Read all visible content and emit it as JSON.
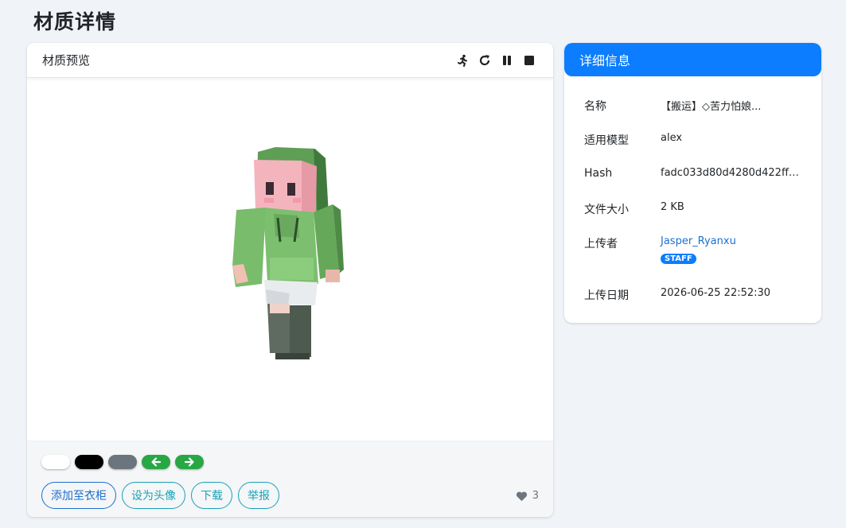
{
  "page": {
    "title": "材质详情"
  },
  "preview": {
    "title": "材质预览",
    "tools": [
      "run-icon",
      "reset-icon",
      "pause-icon",
      "stop-icon"
    ],
    "swatches": [
      {
        "name": "white",
        "color": "#ffffff"
      },
      {
        "name": "black",
        "color": "#000000"
      },
      {
        "name": "gray",
        "color": "#6c757d"
      },
      {
        "name": "prev",
        "color": "#28a745"
      },
      {
        "name": "next",
        "color": "#28a745"
      }
    ],
    "buttons": {
      "add_closet": "添加至衣柜",
      "set_avatar": "设为头像",
      "download": "下载",
      "report": "举报"
    },
    "likes": "3"
  },
  "info": {
    "title": "详细信息",
    "name_label": "名称",
    "name_value": "【搬运】◇苦力怕娘...",
    "model_label": "适用模型",
    "model_value": "alex",
    "hash_label": "Hash",
    "hash_value": "fadc033d80d4280d422ffe...",
    "size_label": "文件大小",
    "size_value": "2 KB",
    "uploader_label": "上传者",
    "uploader_value": "Jasper_Ryanxu",
    "uploader_badge": "STAFF",
    "date_label": "上传日期",
    "date_value": "2026-06-25 22:52:30"
  }
}
